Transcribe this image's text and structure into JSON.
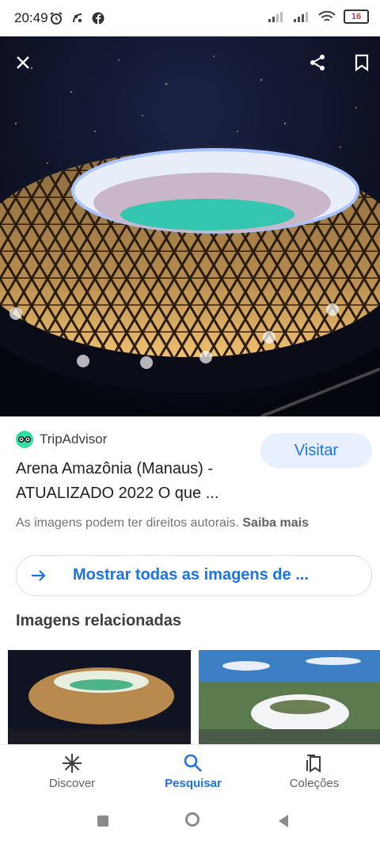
{
  "status_bar": {
    "time": "20:49",
    "battery": "16"
  },
  "hero": {
    "close_icon": "close-icon",
    "share_icon": "share-icon",
    "bookmark_icon": "bookmark-icon"
  },
  "result": {
    "source": "TripAdvisor",
    "title": "Arena Amazônia (Manaus) - ATUALIZADO 2022 O que ...",
    "visit_label": "Visitar",
    "copyright_text": "As imagens podem ter direitos autorais.",
    "learn_more": "Saiba mais"
  },
  "show_all": {
    "label": "Mostrar todas as imagens de ..."
  },
  "related": {
    "heading": "Imagens relacionadas"
  },
  "bottom_nav": {
    "items": [
      {
        "label": "Discover",
        "icon": "asterisk-icon"
      },
      {
        "label": "Pesquisar",
        "icon": "search-icon",
        "active": true
      },
      {
        "label": "Coleções",
        "icon": "collections-icon"
      }
    ]
  },
  "colors": {
    "accent": "#1a73e8",
    "visit_bg": "#e8f0fe",
    "tripadvisor": "#34e0a1"
  }
}
